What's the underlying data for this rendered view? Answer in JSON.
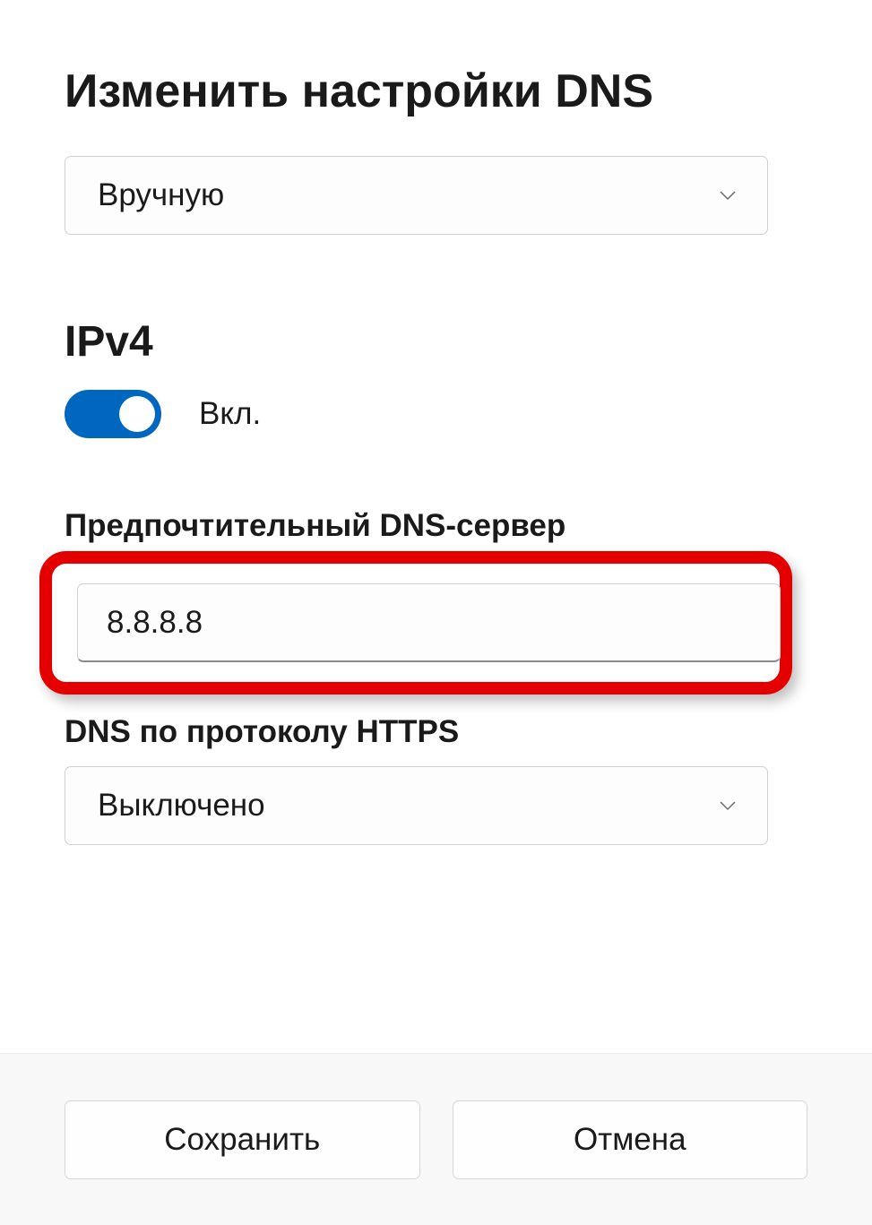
{
  "page_title": "Изменить настройки DNS",
  "mode_dropdown": {
    "selected": "Вручную"
  },
  "ipv4": {
    "section_label": "IPv4",
    "toggle_state_label": "Вкл."
  },
  "preferred_dns": {
    "label": "Предпочтительный DNS-сервер",
    "value": "8.8.8.8"
  },
  "dns_over_https": {
    "label": "DNS по протоколу HTTPS",
    "selected": "Выключено"
  },
  "buttons": {
    "save": "Сохранить",
    "cancel": "Отмена"
  }
}
